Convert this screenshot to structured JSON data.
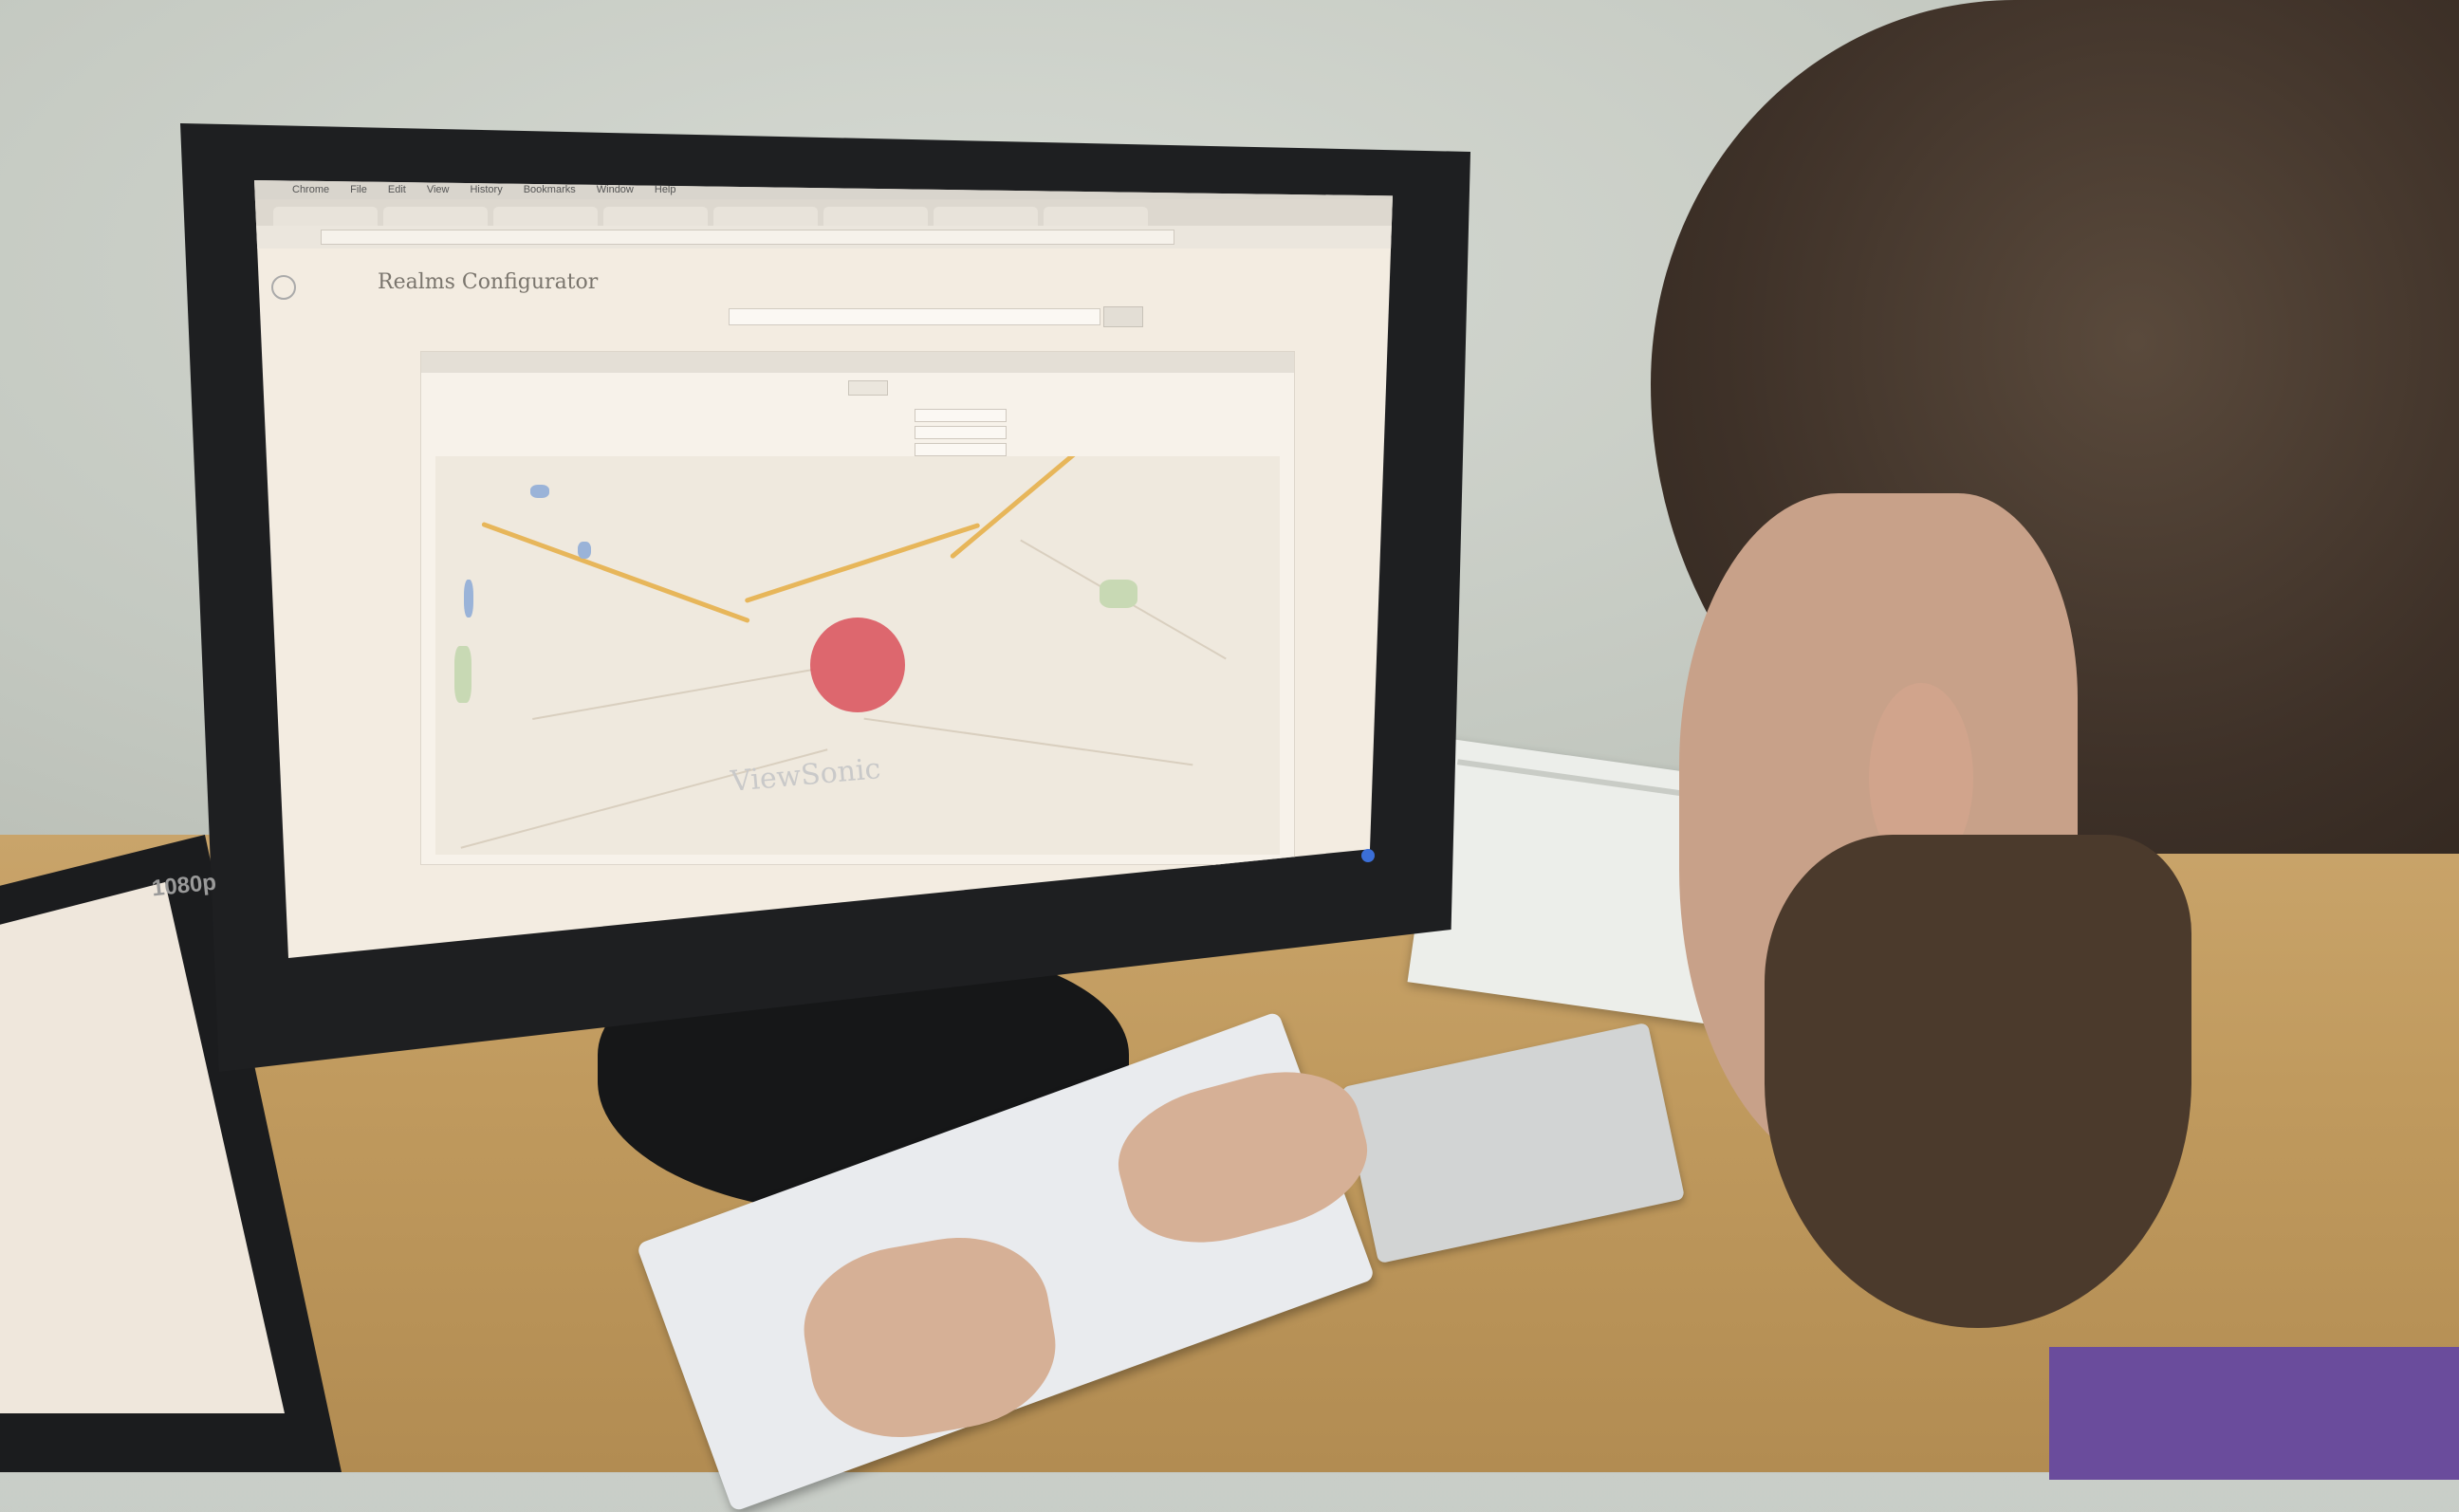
{
  "monitor": {
    "brand": "ViewSonic",
    "badge": "1080p"
  },
  "browser": {
    "menu_items": [
      "Chrome",
      "File",
      "Edit",
      "View",
      "History",
      "Bookmarks",
      "Window",
      "Help"
    ]
  },
  "app": {
    "title": "Realms Configurator"
  },
  "colors": {
    "wall": "#c6cbc3",
    "desk": "#c09a5e",
    "screen_bg": "#f3ece1",
    "map_circle": "#d9505a",
    "road": "#e7b65a"
  }
}
